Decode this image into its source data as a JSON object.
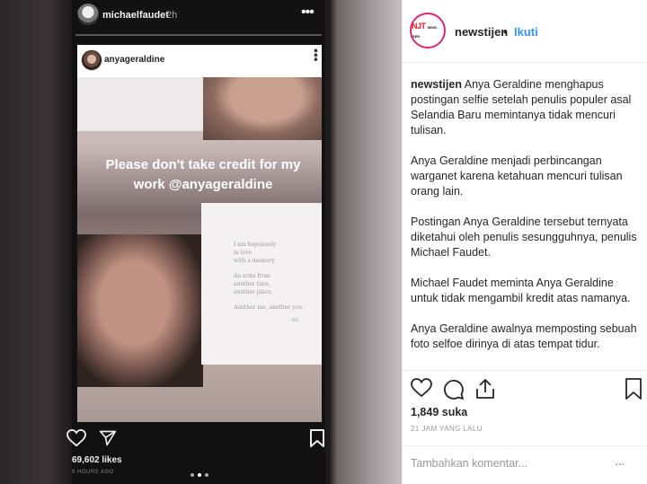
{
  "story": {
    "username": "michaelfaudet",
    "time": "2h",
    "more_icon": "more-dots-icon",
    "likes": "69,602 likes",
    "ago": "9 HOURS AGO"
  },
  "embedded_post": {
    "username": "anyageraldine",
    "quote": "Please don't take credit for my work @anyageraldine",
    "poem_lines": [
      "I am hopelessly",
      "in love",
      "with a memory.",
      "",
      "An echo from",
      "another time,",
      "another place.",
      "",
      "Another me, another you."
    ],
    "poem_signature": "- AG"
  },
  "post": {
    "brand_logo": "NJT",
    "brand_logo_sub": "NEWS TIJEN",
    "username": "newstijen",
    "separator": "•",
    "follow_label": "Ikuti",
    "caption_user": "newstijen",
    "caption_paragraphs": [
      "Anya Geraldine menghapus postingan selfie setelah penulis populer asal Selandia Baru memintanya tidak mencuri tulisan.",
      "Anya Geraldine menjadi perbincangan warganet karena ketahuan mencuri tulisan orang lain.",
      "Postingan Anya Geraldine tersebut ternyata diketahui oleh penulis sesungguhnya, penulis Michael Faudet.",
      "Michael Faudet meminta Anya Geraldine untuk tidak mengambil kredit atas namanya.",
      "Anya Geraldine awalnya memposting sebuah foto selfoe dirinya di atas tempat tidur."
    ],
    "likes": "1,849 suka",
    "time_ago": "21 JAM YANG LALU",
    "comment_placeholder": "Tambahkan komentar...",
    "comment_more": "..."
  },
  "colors": {
    "accent": "#3897f0",
    "brand_red": "#e8202a",
    "text": "#262626",
    "muted": "#999999"
  }
}
